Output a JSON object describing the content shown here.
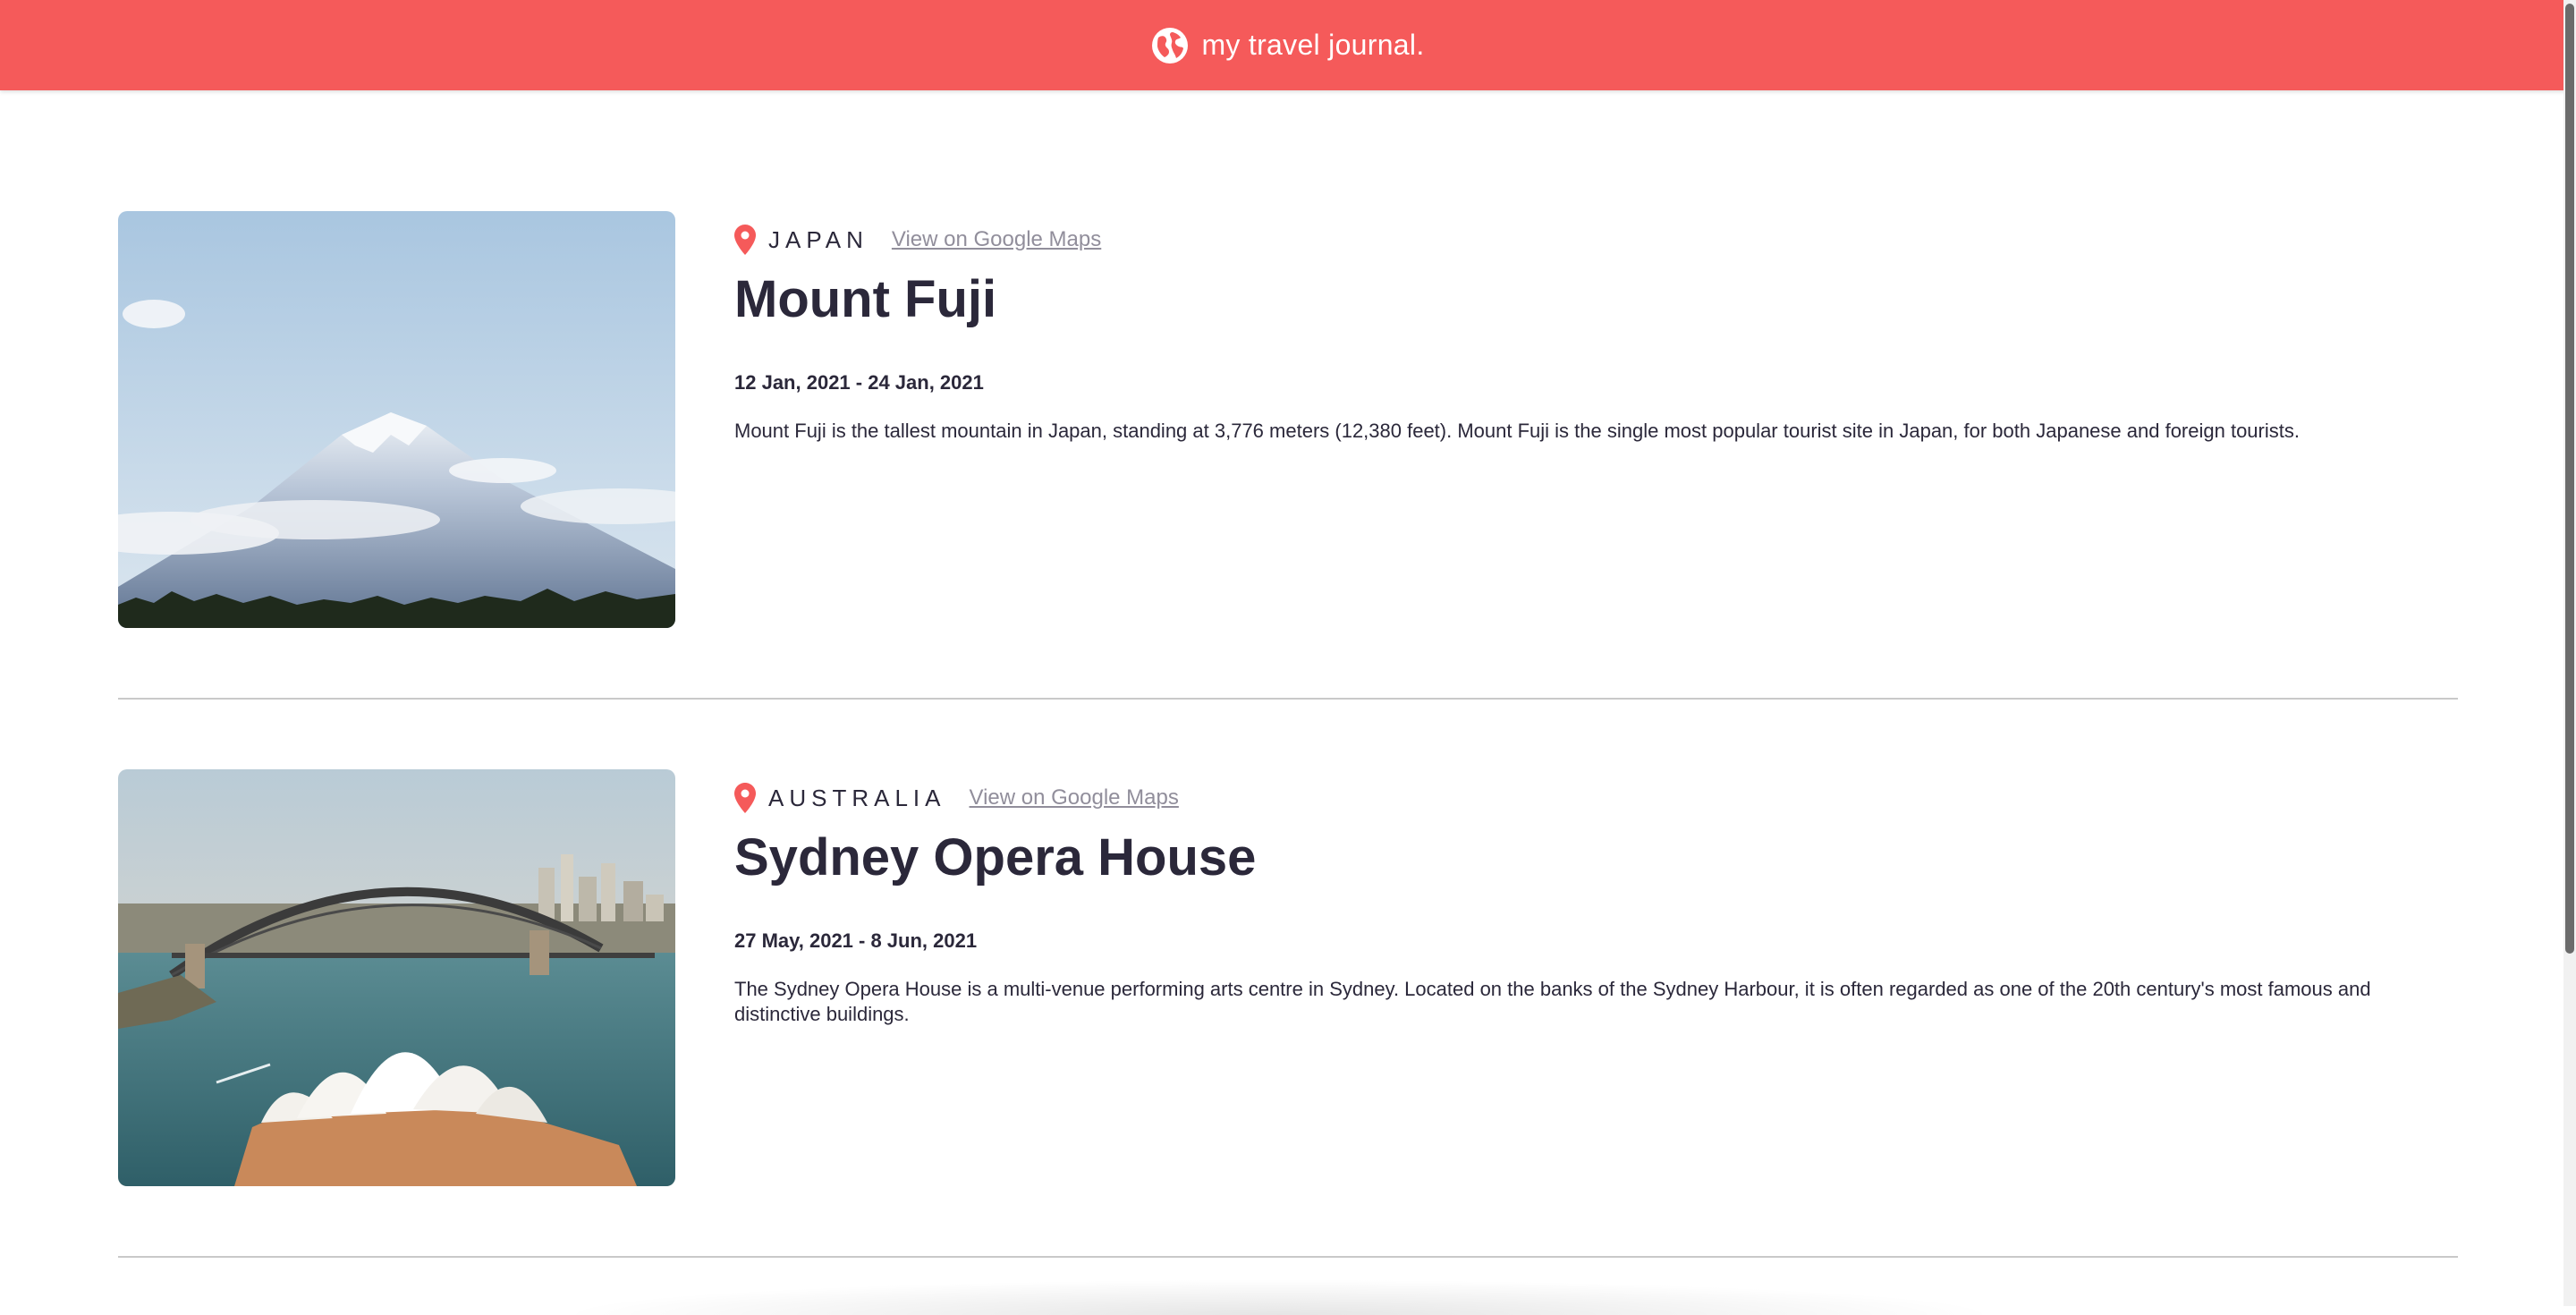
{
  "header": {
    "brand_text": "my travel journal.",
    "icon": "globe-icon",
    "bg_color": "#F55A5A"
  },
  "entries": [
    {
      "country": "JAPAN",
      "maps_link": "View on Google Maps",
      "title": "Mount Fuji",
      "dates": "12 Jan, 2021 - 24 Jan, 2021",
      "description": "Mount Fuji is the tallest mountain in Japan, standing at 3,776 meters (12,380 feet). Mount Fuji is the single most popular tourist site in Japan, for both Japanese and foreign tourists.",
      "image": "mount-fuji-photo"
    },
    {
      "country": "AUSTRALIA",
      "maps_link": "View on Google Maps",
      "title": "Sydney Opera House",
      "dates": "27 May, 2021 - 8 Jun, 2021",
      "description": "The Sydney Opera House is a multi-venue performing arts centre in Sydney. Located on the banks of the Sydney Harbour, it is often regarded as one of the 20th century's most famous and distinctive buildings.",
      "image": "sydney-opera-house-photo"
    }
  ],
  "colors": {
    "accent": "#F55A5A",
    "text": "#2B283A",
    "link": "#918E9B"
  }
}
